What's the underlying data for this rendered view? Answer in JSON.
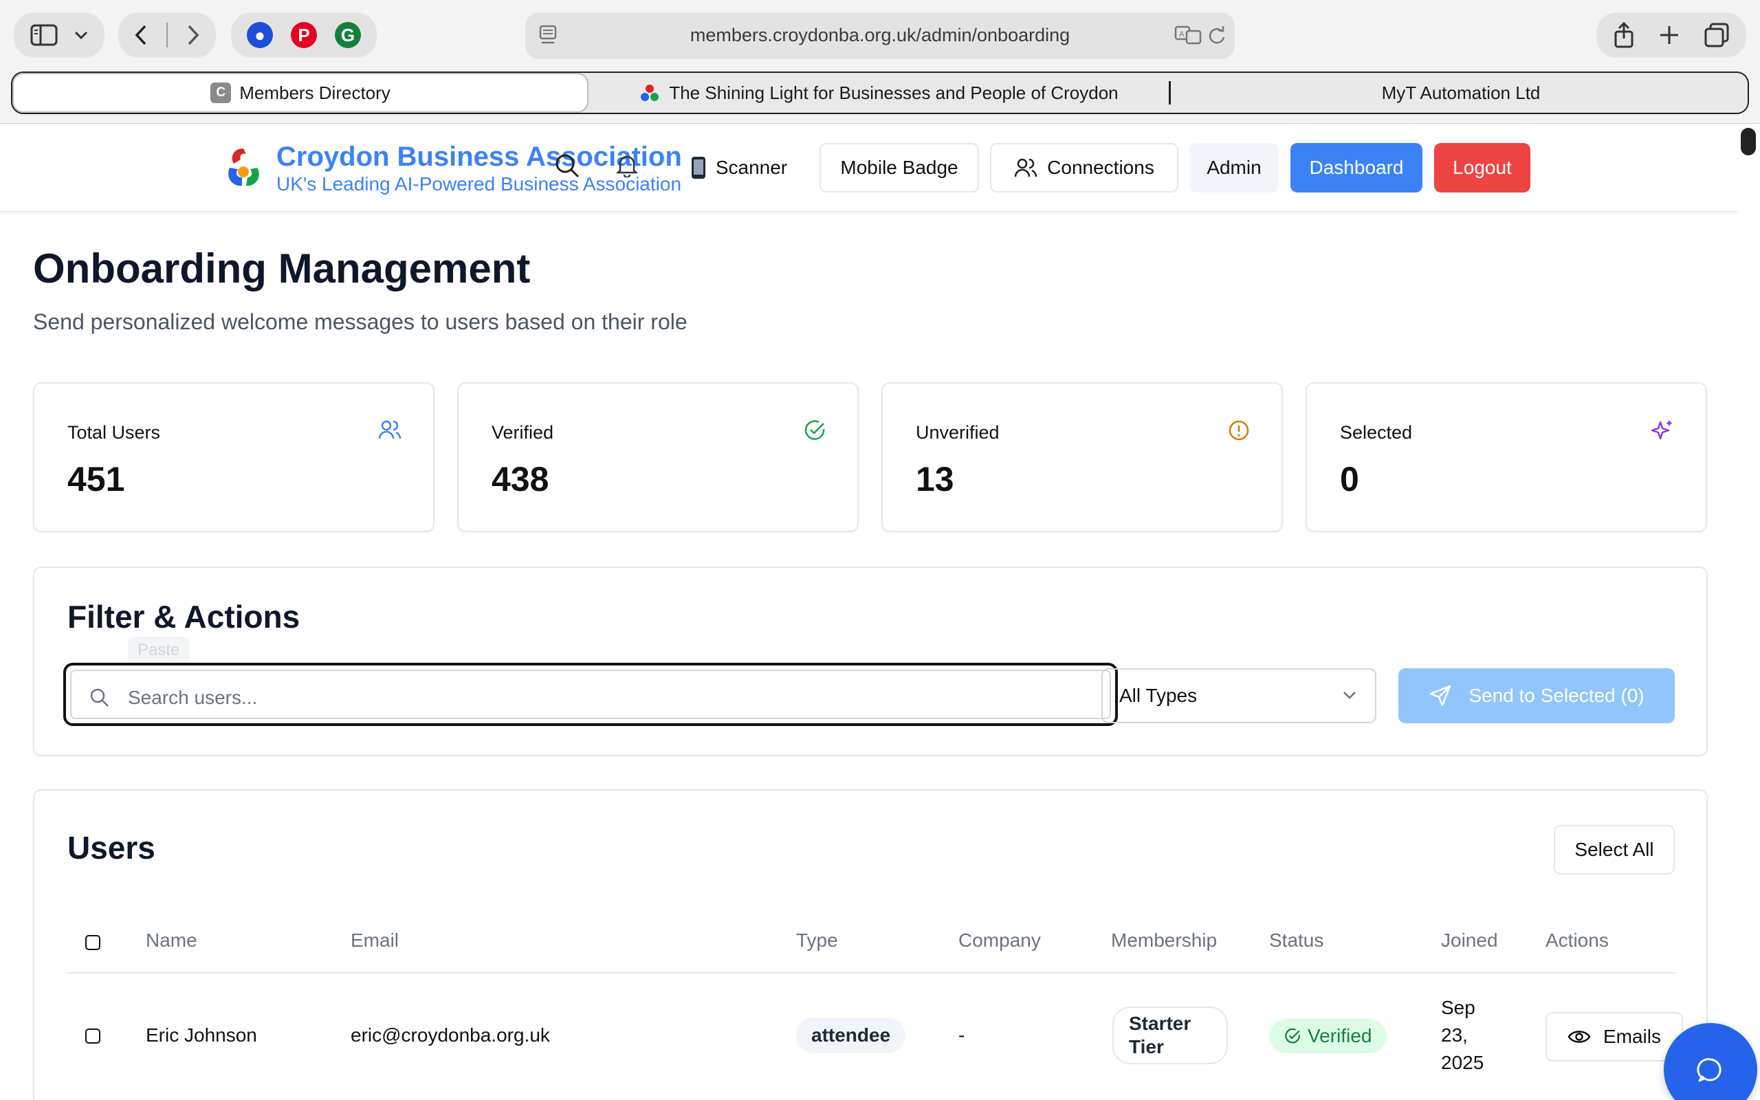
{
  "browser": {
    "url": "members.croydonba.org.uk/admin/onboarding",
    "tabs": [
      {
        "label": "Members Directory",
        "favicon": "C"
      },
      {
        "label": "The Shining Light for Businesses and People of Croydon"
      },
      {
        "label": "MyT Automation Ltd"
      }
    ]
  },
  "header": {
    "brand_title": "Croydon Business Association",
    "brand_subtitle": "UK's Leading AI-Powered Business Association",
    "nav": {
      "scanner": "Scanner",
      "mobile_badge": "Mobile Badge",
      "connections": "Connections",
      "admin": "Admin",
      "dashboard": "Dashboard",
      "logout": "Logout"
    },
    "colors": {
      "dashboard": "#3b82f6",
      "logout": "#ef4444"
    }
  },
  "page": {
    "title": "Onboarding Management",
    "subtitle": "Send personalized welcome messages to users based on their role"
  },
  "stats": [
    {
      "label": "Total Users",
      "value": "451",
      "icon": "users-icon"
    },
    {
      "label": "Verified",
      "value": "438",
      "icon": "check-circle-icon"
    },
    {
      "label": "Unverified",
      "value": "13",
      "icon": "alert-circle-icon"
    },
    {
      "label": "Selected",
      "value": "0",
      "icon": "sparkles-icon"
    }
  ],
  "filter": {
    "title": "Filter & Actions",
    "tooltip": "Paste",
    "search_placeholder": "Search users...",
    "search_value": "",
    "type_select": "All Types",
    "send_button": "Send to Selected (0)"
  },
  "users": {
    "title": "Users",
    "select_all": "Select All",
    "columns": [
      "Name",
      "Email",
      "Type",
      "Company",
      "Membership",
      "Status",
      "Joined",
      "Actions"
    ],
    "rows": [
      {
        "name": "Eric Johnson",
        "email": "eric@croydonba.org.uk",
        "type": "attendee",
        "company": "-",
        "membership_line1": "Starter",
        "membership_line2": "Tier",
        "status": "Verified",
        "joined_line1": "Sep",
        "joined_line2": "23,",
        "joined_line3": "2025",
        "action": "Emails"
      }
    ]
  }
}
